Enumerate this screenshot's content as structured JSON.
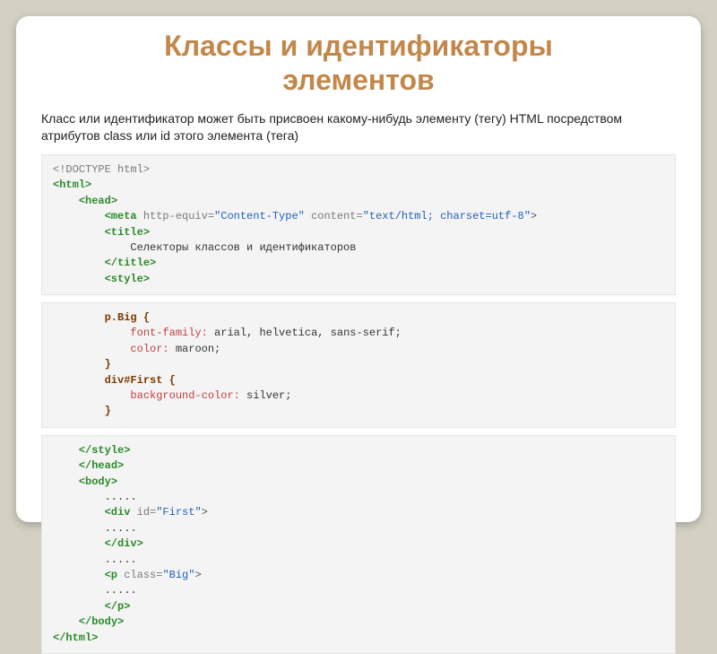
{
  "slide": {
    "title_line1": "Классы и идентификаторы",
    "title_line2": "элементов",
    "description": "Класс или идентификатор может быть присвоен какому-нибудь элементу (тегу) HTML посредством атрибутов class или id этого элемента (тега)"
  },
  "code1": {
    "doctype": "<!DOCTYPE html>",
    "html_open": "<html>",
    "head_open": "<head>",
    "meta_open": "<meta",
    "meta_attr1": " http-equiv=",
    "meta_val1": "\"Content-Type\"",
    "meta_attr2": " content=",
    "meta_val2": "\"text/html; charset=utf-8\"",
    "meta_close": ">",
    "title_open": "<title>",
    "title_text": "Селекторы классов и идентификаторов",
    "title_close": "</title>",
    "style_open": "<style>"
  },
  "code2": {
    "sel1": "p.Big {",
    "prop1": "font-family:",
    "val1": " arial, helvetica, sans-serif;",
    "prop2": "color:",
    "val2": " maroon;",
    "close1": "}",
    "sel2": "div#First {",
    "prop3": "background-color:",
    "val3": " silver;",
    "close2": "}"
  },
  "code3": {
    "style_close": "</style>",
    "head_close": "</head>",
    "body_open": "<body>",
    "dots1": ".....",
    "div_open": "<div",
    "div_attr": " id=",
    "div_val": "\"First\"",
    "gt1": ">",
    "dots2": ".....",
    "div_close": "</div>",
    "dots3": ".....",
    "p_open": "<p",
    "p_attr": " class=",
    "p_val": "\"Big\"",
    "gt2": ">",
    "dots4": ".....",
    "p_close": "</p>",
    "body_close": "</body>",
    "html_close": "</html>"
  }
}
